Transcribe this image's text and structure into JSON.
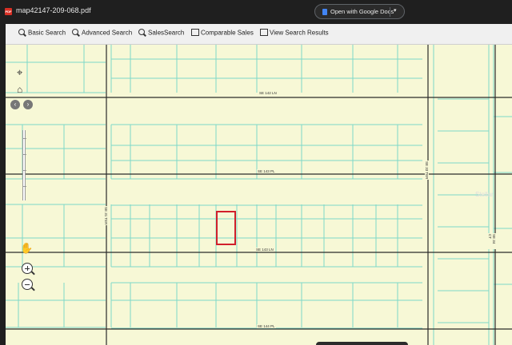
{
  "pdf_viewer": {
    "file_icon": "pdf-icon",
    "filename": "map42147-209-068.pdf",
    "open_button_label": "Open with Google Docs",
    "open_button_icon": "google-docs-icon",
    "open_menu_icon": "chevron-down-icon"
  },
  "toolbar": {
    "items": [
      {
        "label": "Basic Search",
        "icon": "search-icon"
      },
      {
        "label": "Advanced Search",
        "icon": "search-icon"
      },
      {
        "label": "SalesSearch",
        "icon": "search-icon"
      },
      {
        "label": "Comparable Sales",
        "icon": "chart-icon"
      },
      {
        "label": "View Search Results",
        "icon": "table-icon"
      }
    ]
  },
  "map": {
    "road_labels": {
      "se_142_ln": "SE 142 LN",
      "se_143_pl": "SE 143 PL",
      "se_143_ln": "SE 143 LN",
      "se_144_pl": "SE 144 PL",
      "se_33_ter": "SE 33 TER",
      "se_31_ter": "SE 31 TER",
      "se_34_ct": "SE 34 CT"
    },
    "watermark": "Stellar",
    "highlight_color": "#d11f2b",
    "background_color": "#f7f8d6",
    "parcel_line_color": "#7dd8c8",
    "road_line_color": "#2b2b2b"
  },
  "navigation": {
    "pan_icon": "crosshair-icon",
    "home_icon": "home-icon",
    "pan_left_icon": "chevron-left-icon",
    "pan_right_icon": "chevron-right-icon",
    "hand_icon": "hand-icon",
    "zoom_in_icon": "zoom-in-icon",
    "zoom_out_icon": "zoom-out-icon"
  }
}
